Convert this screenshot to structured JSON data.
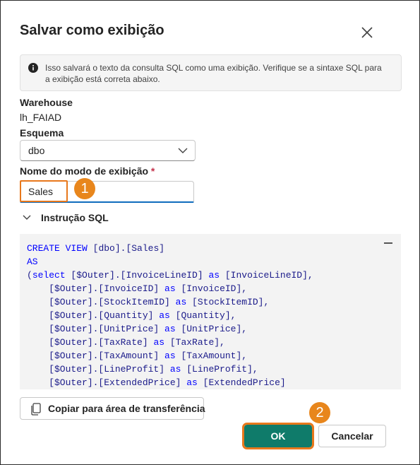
{
  "dialog": {
    "title": "Salvar como exibição",
    "close_icon": "close-icon",
    "info": {
      "icon": "info-icon",
      "text": "Isso salvará o texto da consulta SQL como uma exibição. Verifique se a sintaxe SQL para a exibição está correta abaixo."
    },
    "warehouse": {
      "label": "Warehouse",
      "value": "lh_FAIAD"
    },
    "schema": {
      "label": "Esquema",
      "value": "dbo"
    },
    "view_name": {
      "label": "Nome do modo de exibição",
      "required_mark": "*",
      "value": "Sales"
    },
    "sql_section": {
      "label": "Instrução SQL",
      "lines": [
        "CREATE VIEW [dbo].[Sales]",
        "AS",
        "(select [$Outer].[InvoiceLineID] as [InvoiceLineID],",
        "    [$Outer].[InvoiceID] as [InvoiceID],",
        "    [$Outer].[StockItemID] as [StockItemID],",
        "    [$Outer].[Quantity] as [Quantity],",
        "    [$Outer].[UnitPrice] as [UnitPrice],",
        "    [$Outer].[TaxRate] as [TaxRate],",
        "    [$Outer].[TaxAmount] as [TaxAmount],",
        "    [$Outer].[LineProfit] as [LineProfit],",
        "    [$Outer].[ExtendedPrice] as [ExtendedPrice]"
      ]
    },
    "copy_button": {
      "icon": "copy-icon",
      "label": "Copiar para área de transferência"
    },
    "ok_button": {
      "label": "OK"
    },
    "cancel_button": {
      "label": "Cancelar"
    }
  },
  "callouts": [
    "1",
    "2"
  ],
  "colors": {
    "accent": "#0f7b6a",
    "callout": "#e8861c",
    "highlight": "#e8781c",
    "focus": "#0f6cbd"
  }
}
